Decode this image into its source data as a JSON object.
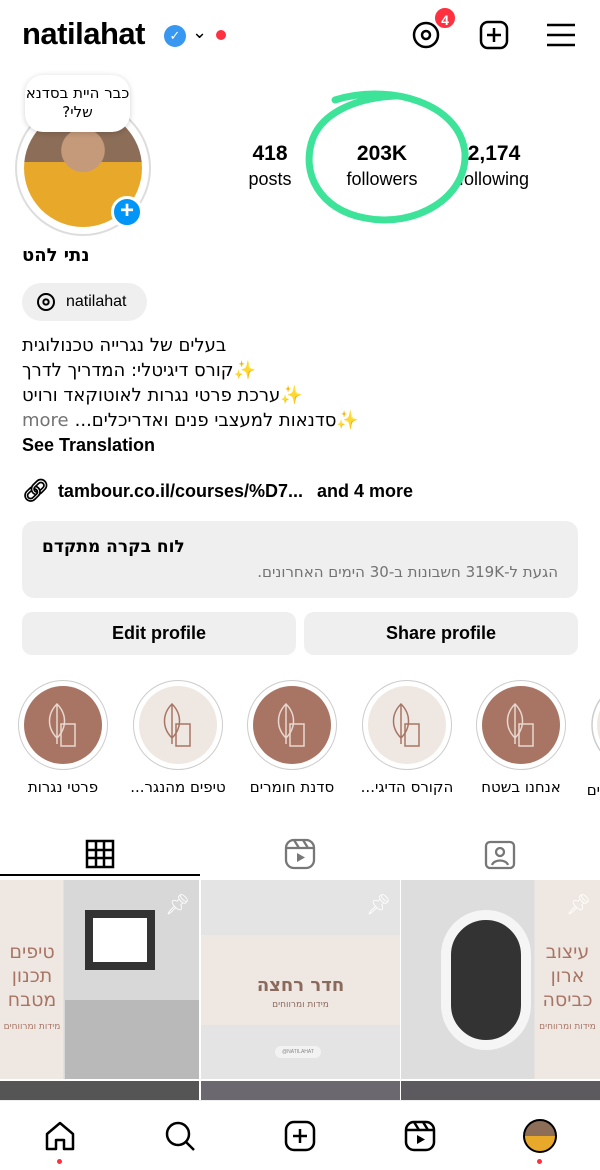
{
  "header": {
    "username": "natilahat",
    "threads_badge": "4"
  },
  "profile": {
    "note_bubble": "כבר היית בסדנא שלי?",
    "display_name": "נתי להט",
    "threads_chip": "natilahat",
    "stats": [
      {
        "value": "418",
        "label": "posts"
      },
      {
        "value": "203K",
        "label": "followers"
      },
      {
        "value": "2,174",
        "label": "following"
      }
    ],
    "bio_lines": [
      "בעלים של נגרייה טכנולוגית",
      "✨קורס דיגיטלי: המדריך לדרך",
      "✨ערכת פרטי נגרות לאוטוקאד ורויט",
      "✨סדנאות למעצבי פנים ואדריכלים..."
    ],
    "bio_more": "more",
    "see_translation": "See Translation",
    "link": "tambour.co.il/courses/%D7...",
    "link_more": "and 4 more"
  },
  "dashboard": {
    "title": "לוח בקרה מתקדם",
    "subtitle": "הגעת ל-319K חשבונות ב-30 הימים האחרונים."
  },
  "buttons": {
    "edit": "Edit profile",
    "share": "Share profile"
  },
  "highlights": [
    {
      "label": "פרטי נגרות",
      "style": "brown"
    },
    {
      "label": "טיפים מהנגר...",
      "style": "beige"
    },
    {
      "label": "סדנת חומרים",
      "style": "brown"
    },
    {
      "label": "הקורס הדיגי...",
      "style": "beige"
    },
    {
      "label": "אנחנו בשטח",
      "style": "brown"
    },
    {
      "label": "ים",
      "style": "beige"
    }
  ],
  "colors": {
    "highlight_brown": "#a87565",
    "highlight_beige": "#efe8e2",
    "annotation": "#3ee39a",
    "accent": "#0095f6"
  },
  "posts": [
    {
      "title": "טיפים תכנון מטבח",
      "subtitle": "מידות ומרווחים",
      "pinned": true
    },
    {
      "title": "חדר רחצה",
      "subtitle": "מידות ומרווחים",
      "tag": "@NATILAHAT",
      "pinned": true
    },
    {
      "title": "עיצוב ארון כביסה",
      "subtitle": "מידות ומרווחים",
      "pinned": true
    }
  ]
}
